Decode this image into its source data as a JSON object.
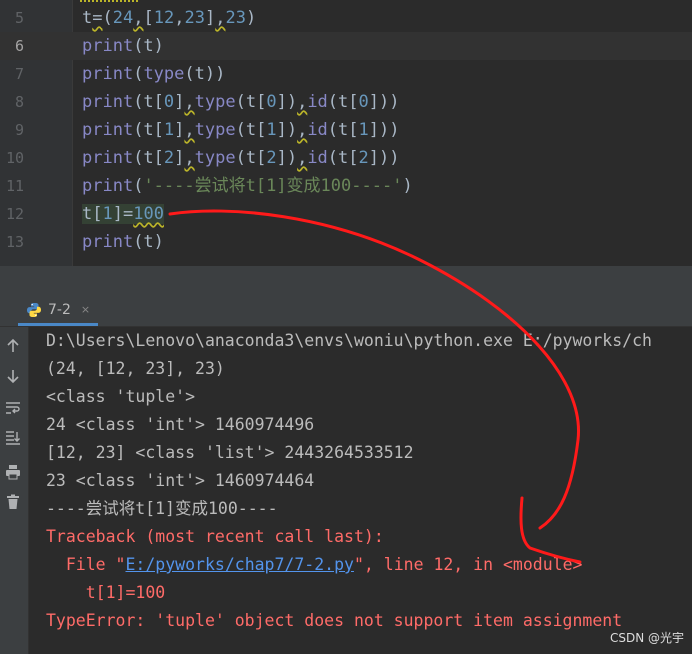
{
  "editor": {
    "lines": [
      {
        "num": "5"
      },
      {
        "num": "6"
      },
      {
        "num": "7"
      },
      {
        "num": "8"
      },
      {
        "num": "9"
      },
      {
        "num": "10"
      },
      {
        "num": "11"
      },
      {
        "num": "12"
      },
      {
        "num": "13"
      }
    ],
    "line11_string": "'----尝试将t[1]变成100----'"
  },
  "run": {
    "tab_label": "7-2",
    "tab_close": "×",
    "output": [
      "D:\\Users\\Lenovo\\anaconda3\\envs\\woniu\\python.exe E:/pyworks/ch",
      "(24, [12, 23], 23)",
      "<class 'tuple'>",
      "24 <class 'int'> 1460974496",
      "[12, 23] <class 'list'> 2443264533512",
      "23 <class 'int'> 1460974464",
      "----尝试将t[1]变成100----",
      "Traceback (most recent call last):"
    ],
    "file_prefix": "  File \"",
    "file_link": "E:/pyworks/chap7/7-2.py",
    "file_suffix": "\", line 12, in <module>",
    "code_line": "    t[1]=100",
    "error": "TypeError: 'tuple' object does not support item assignment"
  },
  "watermark": "CSDN @光宇",
  "colors": {
    "editor_bg": "#2b2b2b",
    "error_red": "#ff6b68",
    "link_blue": "#5394ec",
    "annotation_red": "#ff1a1a"
  },
  "icons": [
    "python-icon",
    "arrow-up-icon",
    "arrow-down-icon",
    "soft-wrap-icon",
    "scroll-to-end-icon",
    "print-icon",
    "trash-icon"
  ]
}
